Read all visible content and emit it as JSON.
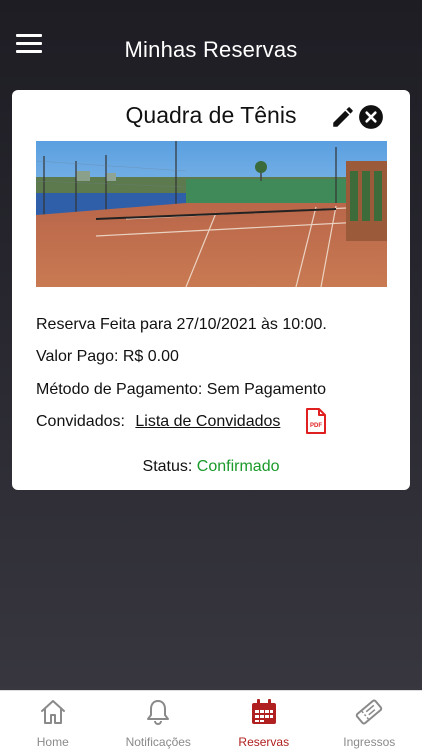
{
  "header": {
    "title": "Minhas Reservas",
    "menu_icon": "hamburger-menu-icon"
  },
  "reservation": {
    "title": "Quadra de Tênis",
    "edit_icon": "pencil-icon",
    "cancel_icon": "close-circle-icon",
    "booking_text": "Reserva Feita para 27/10/2021 às 10:00.",
    "amount_text": "Valor Pago: R$ 0.00",
    "payment_text": "Método de Pagamento: Sem Pagamento",
    "guests_label": "Convidados:",
    "guests_link": "Lista de Convidados",
    "pdf_icon": "pdf-file-icon",
    "pdf_badge": "PDF",
    "status_label": "Status:",
    "status_value": "Confirmado"
  },
  "nav": {
    "items": [
      {
        "label": "Home",
        "icon": "home-icon"
      },
      {
        "label": "Notificações",
        "icon": "bell-icon"
      },
      {
        "label": "Reservas",
        "icon": "calendar-icon"
      },
      {
        "label": "Ingressos",
        "icon": "ticket-icon"
      }
    ],
    "active": "Reservas"
  },
  "colors": {
    "accent": "#b02020",
    "status_confirmed": "#1a9a2a",
    "nav_inactive": "#8a8a8a"
  }
}
